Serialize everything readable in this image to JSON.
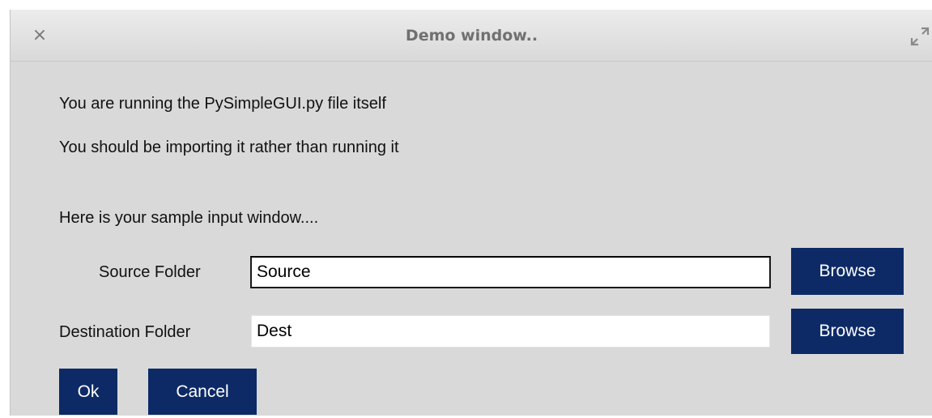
{
  "window": {
    "title": "Demo window..",
    "close_glyph": "×",
    "icons": [
      "close-icon",
      "maximize-icon"
    ]
  },
  "messages": {
    "line1": "You are running the PySimpleGUI.py file itself",
    "line2": "You should be importing it rather than running it",
    "line3": "Here is your sample input window...."
  },
  "form": {
    "source": {
      "label": "Source Folder",
      "value": "Source",
      "browse_label": "Browse"
    },
    "destination": {
      "label": "Destination Folder",
      "value": "Dest",
      "browse_label": "Browse"
    }
  },
  "actions": {
    "ok_label": "Ok",
    "cancel_label": "Cancel"
  },
  "colors": {
    "button_bg": "#0d2a66",
    "button_text": "#ffffff",
    "window_bg": "#d9d9d9"
  }
}
